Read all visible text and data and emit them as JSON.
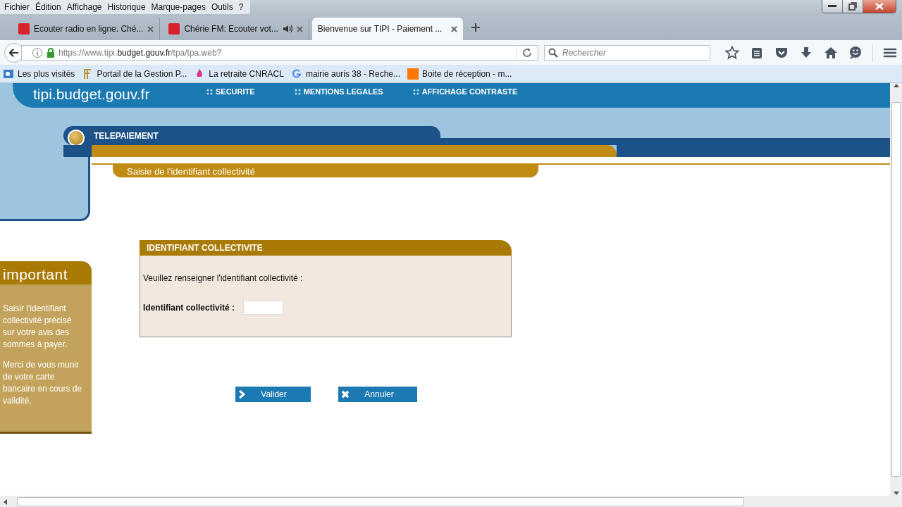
{
  "menu": [
    "Fichier",
    "Édition",
    "Affichage",
    "Historique",
    "Marque-pages",
    "Outils",
    "?"
  ],
  "tabs": [
    {
      "title": "Ecouter radio en ligne. Ché...",
      "selected": false,
      "audio": false
    },
    {
      "title": "Chérie FM: Ecouter vot...",
      "selected": false,
      "audio": true
    },
    {
      "title": "Bienvenue sur TIPI - Paiement ...",
      "selected": true,
      "audio": false
    }
  ],
  "address_bar": {
    "url": "https://www.tipi.**budget.gouv.fr**/tpa/tpa.web?"
  },
  "search": {
    "placeholder": "Rechercher"
  },
  "bookmarks": [
    {
      "label": "Les plus visités",
      "kind": "folder"
    },
    {
      "label": "Portail de la Gestion P...",
      "kind": "letter"
    },
    {
      "label": "La retraite CNRACL",
      "kind": "flame"
    },
    {
      "label": "mairie auris 38 - Reche...",
      "kind": "google"
    },
    {
      "label": "Boite de réception - m...",
      "kind": "orange"
    }
  ],
  "site": {
    "logo": "tipi.budget.gouv.fr",
    "links": [
      "SECURITE",
      "MENTIONS LEGALES",
      "AFFICHAGE CONTRASTE"
    ],
    "section": "TELEPAIEMENT",
    "step": "Saisie de l'identifiant collectivité",
    "important": {
      "title": "important",
      "paragraphs": [
        "Saisir l'identifiant collectivité précisé sur votre avis des sommes à payer.",
        "Merci de vous munir de votre carte bancaire en cours de validité."
      ]
    },
    "form": {
      "title": "IDENTIFIANT COLLECTIVITE",
      "instruction": "Veuillez renseigner l'identifiant collectivité :",
      "field_label": "Identifiant collectivité :"
    },
    "buttons": [
      {
        "label": "Valider",
        "kind": "validate"
      },
      {
        "label": "Annuler",
        "kind": "cancel"
      }
    ]
  }
}
